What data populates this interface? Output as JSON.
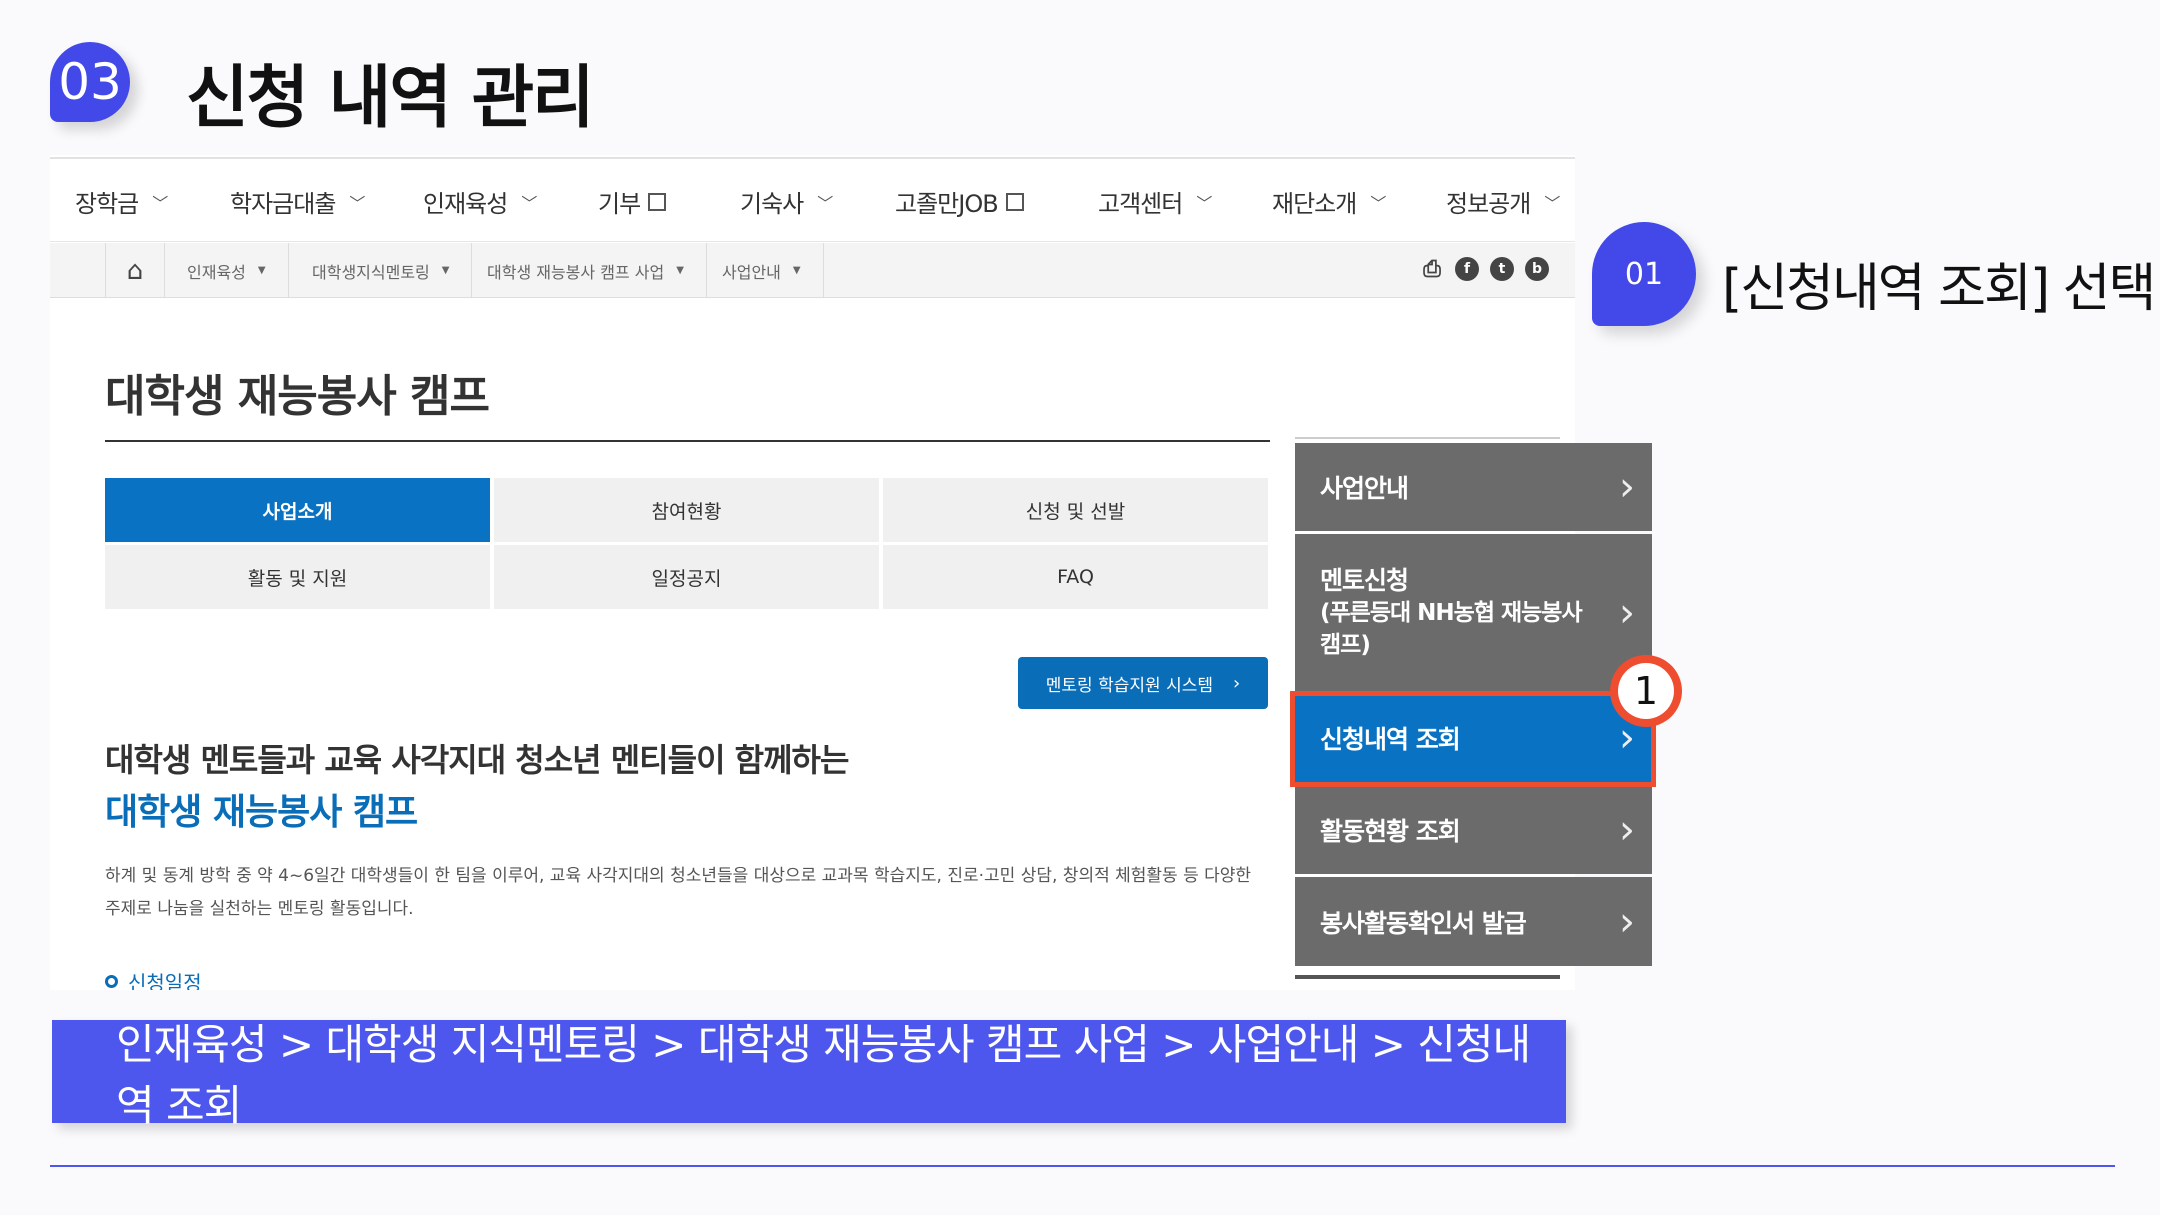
{
  "header": {
    "step": "03",
    "title": "신청 내역 관리"
  },
  "gnb": [
    {
      "label": "장학금",
      "type": "dropdown"
    },
    {
      "label": "학자금대출",
      "type": "dropdown"
    },
    {
      "label": "인재육성",
      "type": "dropdown"
    },
    {
      "label": "기부",
      "type": "external"
    },
    {
      "label": "기숙사",
      "type": "dropdown"
    },
    {
      "label": "고졸만JOB",
      "type": "external"
    },
    {
      "label": "고객센터",
      "type": "dropdown"
    },
    {
      "label": "재단소개",
      "type": "dropdown"
    },
    {
      "label": "정보공개",
      "type": "dropdown"
    }
  ],
  "breadcrumb": {
    "home_icon": "home-icon",
    "items": [
      "인재육성",
      "대학생지식멘토링",
      "대학생 재능봉사 캠프 사업",
      "사업안내"
    ],
    "share_icons": [
      "print-icon",
      "facebook-icon",
      "twitter-icon",
      "blog-icon"
    ]
  },
  "content": {
    "title": "대학생 재능봉사 캠프",
    "tabs": [
      {
        "label": "사업소개",
        "active": true
      },
      {
        "label": "참여현황",
        "active": false
      },
      {
        "label": "신청 및 선발",
        "active": false
      },
      {
        "label": "활동 및 지원",
        "active": false
      },
      {
        "label": "일정공지",
        "active": false
      },
      {
        "label": "FAQ",
        "active": false
      }
    ],
    "mentor_button": "멘토링 학습지원 시스템",
    "headline": "대학생 멘토들과 교육 사각지대 청소년 멘티들이 함께하는",
    "headline_blue": "대학생 재능봉사 캠프",
    "desc_line1": "하계 및 동계 방학 중 약 4~6일간 대학생들이 한 팀을 이루어, 교육 사각지대의 청소년들을 대상으로 교과목 학습지도, 진로·고민 상담, 창의적 체험활동 등 다양한",
    "desc_line2": "주제로 나눔을 실천하는 멘토링 활동입니다.",
    "schedule_label": "신청일정"
  },
  "side_menu": [
    {
      "label": "사업안내",
      "active": false
    },
    {
      "label": "멘토신청",
      "label2": "(푸른등대 NH농협 재능봉사",
      "label3": "캠프)",
      "active": false
    },
    {
      "label": "신청내역 조회",
      "active": true
    },
    {
      "label": "활동현황 조회",
      "active": false
    },
    {
      "label": "봉사활동확인서 발급",
      "active": false
    }
  ],
  "annotation": {
    "marker": "1",
    "sub_step": "01",
    "instruction": "[신청내역 조회] 선택",
    "highlight_color": "#ef4d2f"
  },
  "path_bar": "인재육성 > 대학생 지식멘토링 > 대학생 재능봉사 캠프 사업 > 사업안내 > 신청내역 조회",
  "colors": {
    "accent": "#4d57ee",
    "site_blue": "#0a72c2",
    "menu_gray": "#6b6b6b"
  }
}
